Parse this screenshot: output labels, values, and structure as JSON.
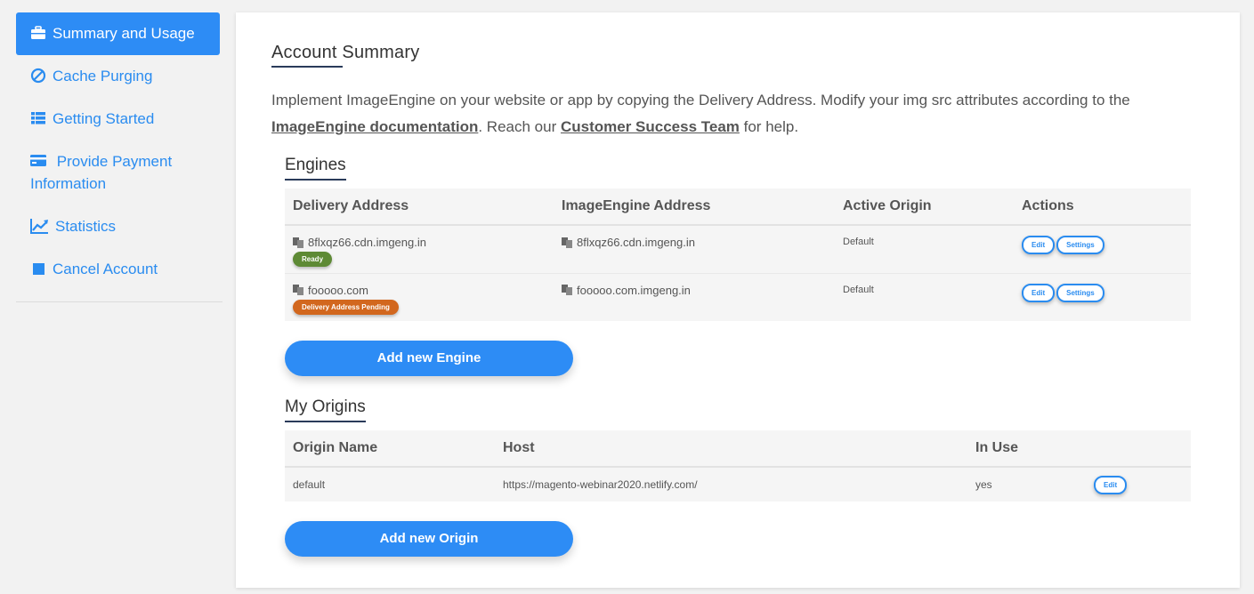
{
  "sidebar": {
    "items": [
      {
        "label": "Summary and Usage",
        "icon": "briefcase-icon"
      },
      {
        "label": "Cache Purging",
        "icon": "ban-icon"
      },
      {
        "label": "Getting Started",
        "icon": "list-icon"
      },
      {
        "label": "Provide Payment Information",
        "icon": "credit-card-icon"
      },
      {
        "label": "Statistics",
        "icon": "line-chart-icon"
      },
      {
        "label": "Cancel Account",
        "icon": "stop-icon"
      }
    ]
  },
  "main": {
    "title": "Account Summary",
    "intro": {
      "text_1": "Implement ImageEngine on your website or app by copying the Delivery Address. Modify your img src attributes according to the ",
      "doc_link": "ImageEngine documentation",
      "text_2": ". Reach our ",
      "team_link": "Customer Success Team",
      "text_3": " for help."
    },
    "engines": {
      "title": "Engines",
      "headers": [
        "Delivery Address",
        "ImageEngine Address",
        "Active Origin",
        "Actions"
      ],
      "rows": [
        {
          "delivery": "8flxqz66.cdn.imgeng.in",
          "status": "Ready",
          "imageengine": "8flxqz66.cdn.imgeng.in",
          "origin": "Default",
          "edit": "Edit",
          "settings": "Settings"
        },
        {
          "delivery": "fooooo.com",
          "status": "Delivery Address Pending",
          "imageengine": "fooooo.com.imgeng.in",
          "origin": "Default",
          "edit": "Edit",
          "settings": "Settings"
        }
      ],
      "add_button": "Add new Engine"
    },
    "origins": {
      "title": "My Origins",
      "headers": [
        "Origin Name",
        "Host",
        "In Use"
      ],
      "rows": [
        {
          "name": "default",
          "host": "https://magento-webinar2020.netlify.com/",
          "in_use": "yes",
          "edit": "Edit"
        }
      ],
      "add_button": "Add new Origin"
    }
  },
  "colors": {
    "accent": "#2d8cf5",
    "ready": "#5e8a35",
    "pending": "#d2671e"
  }
}
